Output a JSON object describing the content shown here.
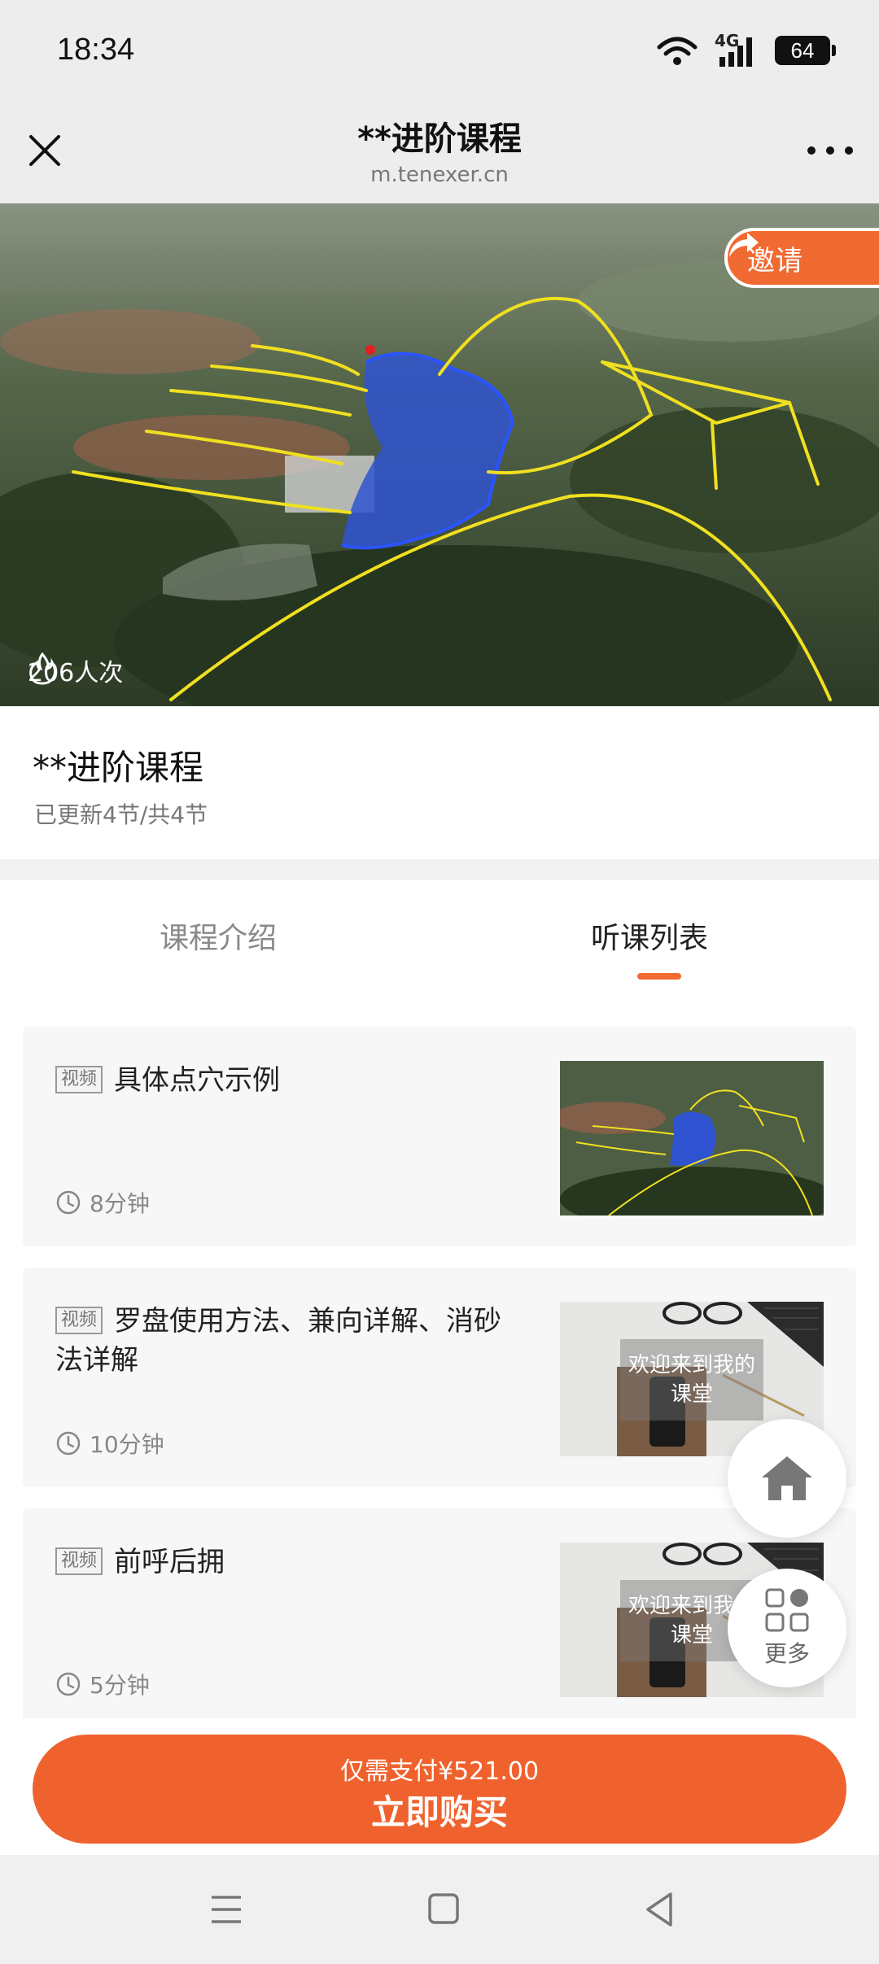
{
  "status_bar": {
    "time": "18:34",
    "network": "4G",
    "battery": "64"
  },
  "nav": {
    "title": "**进阶课程",
    "domain": "m.tenexer.cn"
  },
  "hero": {
    "invite_label": "邀请",
    "views": "206人次"
  },
  "course": {
    "title": "**进阶课程",
    "subtitle": "已更新4节/共4节"
  },
  "tabs": [
    {
      "label": "课程介绍",
      "active": false
    },
    {
      "label": "听课列表",
      "active": true
    }
  ],
  "lessons": [
    {
      "badge": "视频",
      "title": "具体点穴示例",
      "duration": "8分钟",
      "thumb_caption": ""
    },
    {
      "badge": "视频",
      "title": "罗盘使用方法、兼向详解、消砂法详解",
      "duration": "10分钟",
      "thumb_caption": "欢迎来到我的课堂"
    },
    {
      "badge": "视频",
      "title": "前呼后拥",
      "duration": "5分钟",
      "thumb_caption": "欢迎来到我的课堂"
    }
  ],
  "floating": {
    "home_icon": "home-icon",
    "more_label": "更多"
  },
  "buy": {
    "price_text": "仅需支付¥521.00",
    "action_label": "立即购买"
  },
  "colors": {
    "accent": "#f0622d",
    "tab_active_underline": "#f06a32"
  }
}
